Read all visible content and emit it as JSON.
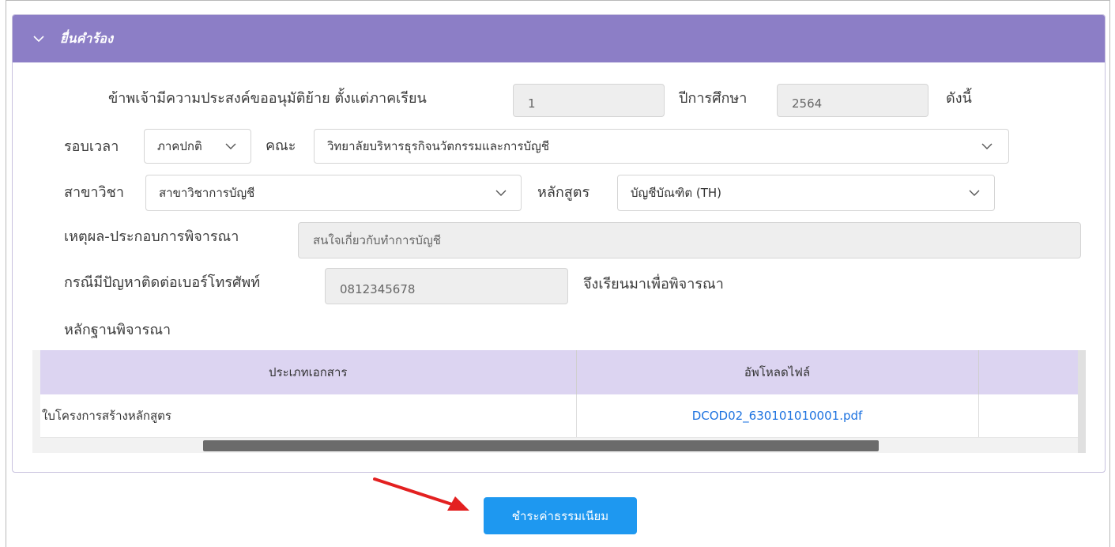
{
  "panel": {
    "title": "ยื่นคำร้อง"
  },
  "form": {
    "intro_label": "ข้าพเจ้ามีความประสงค์ขออนุมัติย้าย ตั้งแต่ภาคเรียน",
    "semester_value": "1",
    "year_label": "ปีการศึกษา",
    "year_value": "2564",
    "as_follows_label": "ดังนี้",
    "period_label": "รอบเวลา",
    "period_value": "ภาคปกติ",
    "faculty_label": "คณะ",
    "faculty_value": "วิทยาลัยบริหารธุรกิจนวัตกรรมและการบัญชี",
    "major_label": "สาขาวิชา",
    "major_value": "สาขาวิชาการบัญชี",
    "curriculum_label": "หลักสูตร",
    "curriculum_value": "บัญชีบัณฑิต (TH)",
    "reason_label": "เหตุผล-ประกอบการพิจารณา",
    "reason_value": "สนใจเกี่ยวกับทำการบัญชี",
    "phone_label": "กรณีมีปัญหาติดต่อเบอร์โทรศัพท์",
    "phone_value": "0812345678",
    "consider_label": "จึงเรียนมาเพื่อพิจารณา",
    "evidence_label": "หลักฐานพิจารณา"
  },
  "evidence_table": {
    "headers": [
      "ประเภทเอกสาร",
      "อัพโหลดไฟล์",
      ""
    ],
    "rows": [
      {
        "type": "ใบโครงการสร้างหลักสูตร",
        "file": "DCOD02_630101010001.pdf"
      }
    ]
  },
  "actions": {
    "pay_label": "ชำระค่าธรรมเนียม"
  },
  "colors": {
    "header": "#8c7ec6",
    "table_header": "#dcd4f1",
    "button": "#1e98f0",
    "link": "#1e73e0",
    "arrow": "#e32020"
  }
}
